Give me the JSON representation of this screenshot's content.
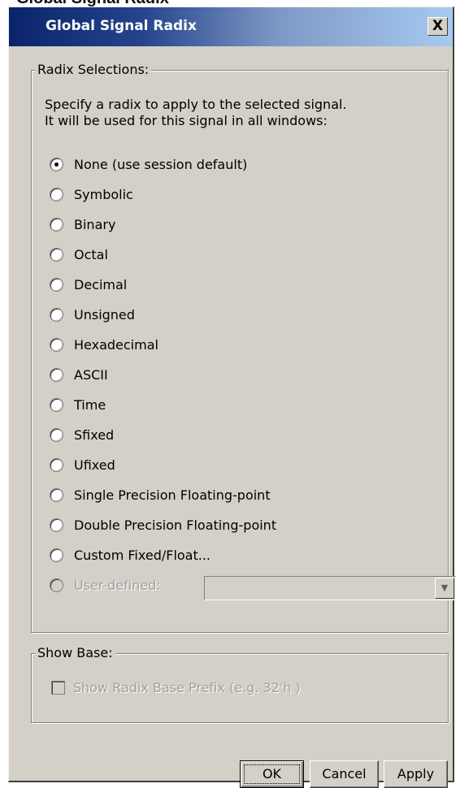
{
  "background_title": "Global Signal Radix",
  "dialog": {
    "title": "Global Signal Radix",
    "close_label": "X"
  },
  "radix_group": {
    "legend": "Radix Selections:",
    "instruction_line1": "Specify a radix to apply to the selected signal.",
    "instruction_line2": "It will be used for this signal in all windows:",
    "options": [
      {
        "label": "None (use session default)",
        "checked": true
      },
      {
        "label": "Symbolic",
        "checked": false
      },
      {
        "label": "Binary",
        "checked": false
      },
      {
        "label": "Octal",
        "checked": false
      },
      {
        "label": "Decimal",
        "checked": false
      },
      {
        "label": "Unsigned",
        "checked": false
      },
      {
        "label": "Hexadecimal",
        "checked": false
      },
      {
        "label": "ASCII",
        "checked": false
      },
      {
        "label": "Time",
        "checked": false
      },
      {
        "label": "Sfixed",
        "checked": false
      },
      {
        "label": "Ufixed",
        "checked": false
      },
      {
        "label": "Single Precision Floating-point",
        "checked": false
      },
      {
        "label": "Double Precision Floating-point",
        "checked": false
      },
      {
        "label": "Custom Fixed/Float...",
        "checked": false
      }
    ],
    "user_defined": {
      "label": "User-defined:",
      "enabled": false,
      "value": ""
    }
  },
  "show_base_group": {
    "legend": "Show Base:",
    "checkbox_label": "Show Radix Base Prefix (e.g. 32'h )",
    "checked": false,
    "enabled": false
  },
  "buttons": {
    "ok": "OK",
    "cancel": "Cancel",
    "apply": "Apply"
  },
  "colors": {
    "title_gradient_start": "#0a246a",
    "title_gradient_end": "#a6caf0",
    "dialog_face": "#d4d0c8",
    "disabled_text": "#a0a0a0"
  }
}
